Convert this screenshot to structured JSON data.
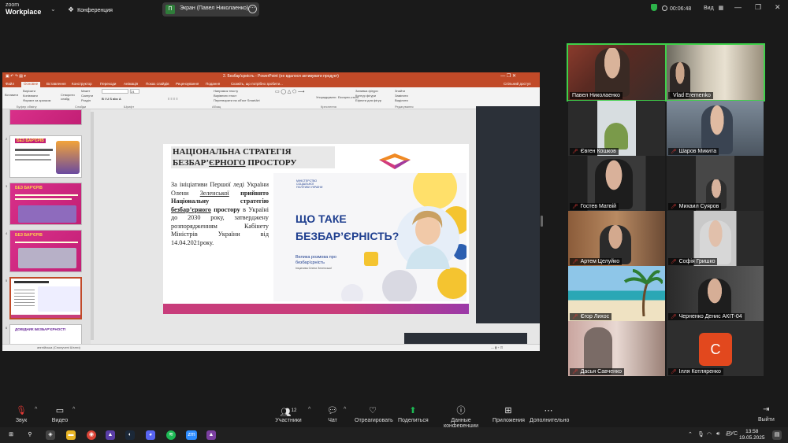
{
  "topbar": {
    "app_line1": "zoom",
    "app_line2": "Workplace",
    "meeting_label": "Конференция",
    "share_initial": "П",
    "share_label": "Экран (Павел Николаенко)",
    "timer": "00:06:48",
    "view_label": "Вид",
    "colors": {
      "secure": "#2db34a",
      "share_avatar": "#2f7d3a"
    }
  },
  "ppt": {
    "title": "2. Безбар'єрність - PowerPoint (не вдалося активувати продукт)",
    "tabs": [
      "Файл",
      "Основне",
      "Вставлення",
      "Конструктор",
      "Переходи",
      "Анімація",
      "Показ слайдів",
      "Рецензування",
      "Подання"
    ],
    "tell_me": "Скажіть, що потрібно зробити...",
    "share_btn": "Спільний доступ",
    "ribbon": {
      "paste": "Вставити",
      "cut": "Вирізати",
      "copy": "Копіювати",
      "format": "Формат за зразком",
      "clipboard": "Буфер обміну",
      "new_slide": "Створити слайд",
      "layout": "Макет",
      "reset": "Скинути",
      "section": "Розділ",
      "slides": "Слайди",
      "font": "Шрифт",
      "font_size": "24",
      "paragraph": "Абзац",
      "text_dir": "Напрямок тексту",
      "align_text": "Вирівняти текст",
      "smartart": "Перетворити на об'єкт SmartArt",
      "arrange": "Упорядкувати",
      "express": "Експрес-стилі",
      "drawing": "Креслення",
      "fill": "Заливка фігури",
      "outline": "Контур фігури",
      "effects": "Ефекти для фігур",
      "find": "Знайти",
      "replace": "Замінити",
      "select": "Виділити",
      "editing": "Редагування"
    },
    "thumbnails": [
      {
        "num": "",
        "caption": ""
      },
      {
        "num": "2",
        "caption": "БЕЗ БАР'ЄРІВ"
      },
      {
        "num": "3",
        "caption": "БЕЗ БАР'ЄРІВ"
      },
      {
        "num": "4",
        "caption": "БЕЗ БАР'ЄРІВ"
      },
      {
        "num": "5",
        "caption": ""
      },
      {
        "num": "6",
        "caption": "ДОВІДНИК БЕЗБАР'ЄРНОСТІ"
      }
    ],
    "status_lang": "англійська (Сполучені Штати)"
  },
  "slide": {
    "title_line1": "НАЦІОНАЛЬНА СТРАТЕГІЯ",
    "title_line2a": "БЕЗБАР’",
    "title_line2b": "ЄРНОГО",
    "title_line2c": " ПРОСТОРУ",
    "body_p1": "За ініціативи Першої леді України Олени ",
    "body_name": "Зеленської",
    "body_bold1": " прийнято Національну стратегію ",
    "body_bold_ul": "безбар’єрного",
    "body_bold2": " простору",
    "body_rest": " в Україні до 2030 року, затверджену розпорядженням Кабінету Міністрів України від 14.04.2021року.",
    "ministry": "МІНІСТЕРСТВО СОЦІАЛЬНОЇ ПОЛІТИКИ УКРАЇНИ",
    "headline1": "ЩО ТАКЕ",
    "headline2": "БЕЗБАР’ЄРНІСТЬ?",
    "sub1": "Велика розмова про",
    "sub2": "безбар'єрність",
    "sub3": "Ініціатива Олени Зеленської",
    "colors": {
      "accent": "#c83d7b",
      "headline": "#1f3f8f"
    }
  },
  "participants": [
    {
      "name": "Павел Николаенко",
      "muted": false
    },
    {
      "name": "Vlad Eremenko",
      "muted": false
    },
    {
      "name": "Євген Кошков",
      "muted": true
    },
    {
      "name": "Шаров Микита",
      "muted": true
    },
    {
      "name": "Гостев Матвій",
      "muted": true
    },
    {
      "name": "Михаил Суяров",
      "muted": true
    },
    {
      "name": "Артем Целуйко",
      "muted": true
    },
    {
      "name": "Софія Гришко",
      "muted": true
    },
    {
      "name": "Єгор Лиxoc",
      "muted": true
    },
    {
      "name": "Черненко Денис АКІТ-04",
      "muted": true
    },
    {
      "name": "Дасья Савченко",
      "muted": true
    },
    {
      "name": "Ілля Котляренко",
      "muted": true,
      "initial": "С"
    }
  ],
  "toolbar": {
    "audio": "Звук",
    "video": "Видео",
    "participants": "Участники",
    "participants_count": "12",
    "chat": "Чат",
    "react": "Отреагировать",
    "share": "Поделиться",
    "meeting_info": "Данные конференции",
    "apps": "Приложения",
    "more": "Дополнительно",
    "exit": "Выйти"
  },
  "taskbar": {
    "lang": "РУС",
    "time": "13:58",
    "date": "19.05.2025",
    "zoom_icon": "zm"
  }
}
